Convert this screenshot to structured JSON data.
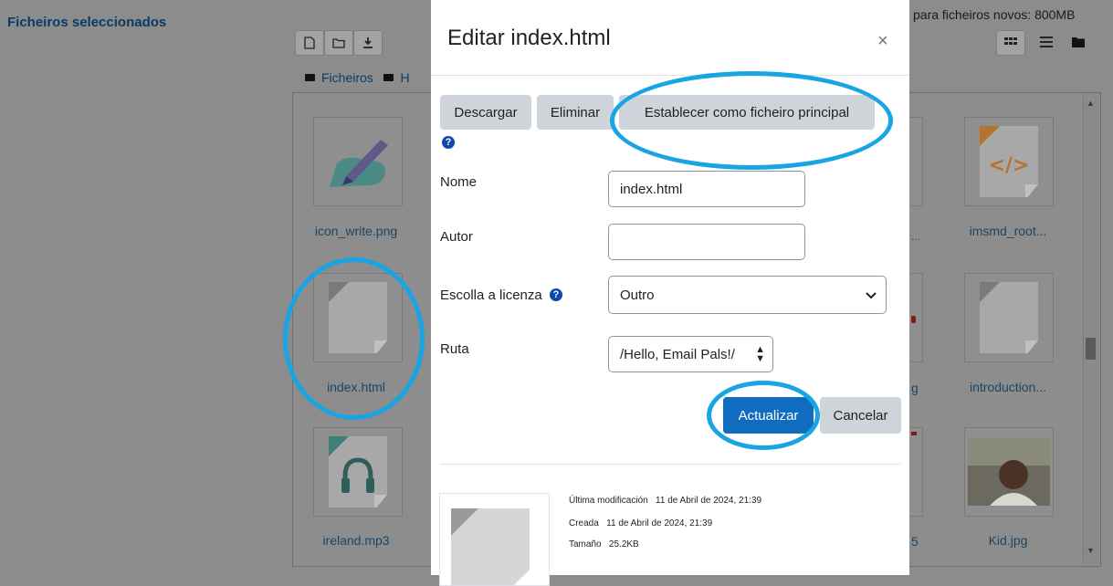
{
  "background": {
    "section_label": "Ficheiros seleccionados",
    "quota_text": "para ficheiros novos: 800MB",
    "breadcrumb": {
      "root": "Ficheiros",
      "next": "H"
    },
    "files": [
      {
        "name": "icon_write.png"
      },
      {
        "name": "index.html"
      },
      {
        "name": "ireland.mp3"
      },
      {
        "name": "imsmd_root..."
      },
      {
        "name": "introduction..."
      },
      {
        "name": "Kid.jpg"
      }
    ],
    "partial_names": [
      "...",
      "g",
      "5"
    ]
  },
  "modal": {
    "title": "Editar index.html",
    "close_symbol": "×",
    "actions": {
      "download": "Descargar",
      "delete": "Eliminar",
      "set_main": "Establecer como ficheiro principal"
    },
    "help_symbol": "?",
    "fields": {
      "name_label": "Nome",
      "name_value": "index.html",
      "author_label": "Autor",
      "author_value": "",
      "license_label": "Escolla a licenza",
      "license_value": "Outro",
      "path_label": "Ruta",
      "path_value": "/Hello, Email Pals!/"
    },
    "buttons": {
      "update": "Actualizar",
      "cancel": "Cancelar"
    },
    "metadata": {
      "modified_label": "Última modificación",
      "modified_value": "11 de Abril de 2024, 21:39",
      "created_label": "Creada",
      "created_value": "11 de Abril de 2024, 21:39",
      "size_label": "Tamaño",
      "size_value": "25.2KB"
    }
  },
  "colors": {
    "accent": "#0f6cbf",
    "annotation": "#19a5e3",
    "overlay": "#8c8c8c"
  }
}
